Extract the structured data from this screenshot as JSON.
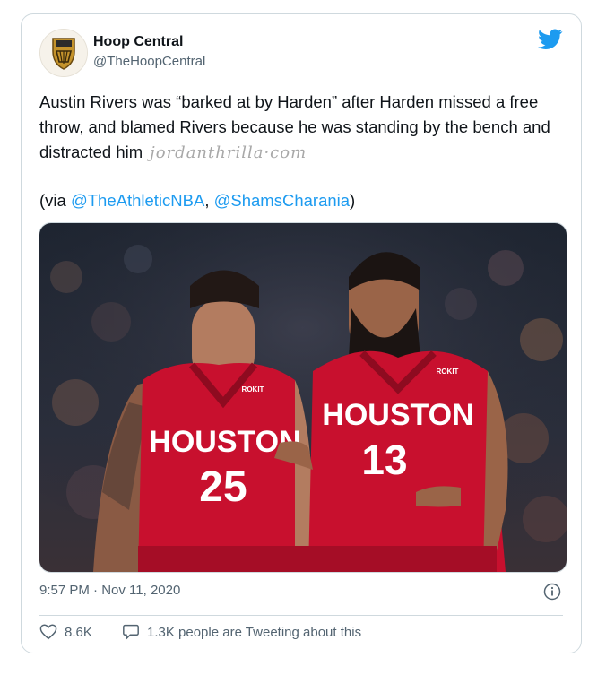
{
  "tweet": {
    "author_name": "Hoop Central",
    "author_handle": "@TheHoopCentral",
    "body_text": "Austin Rivers was “barked at by Harden” after Harden missed a free throw, and blamed Rivers because he was standing by the bench and distracted him",
    "watermark": "jordanthrilla·com",
    "via_prefix": "(via ",
    "via_link_1": "@TheAthleticNBA",
    "via_separator": ", ",
    "via_link_2": "@ShamsCharania",
    "via_suffix": ")",
    "timestamp": "9:57 PM · Nov 11, 2020",
    "likes": "8.6K",
    "conversation": "1.3K people are Tweeting about this"
  },
  "photo": {
    "left_jersey_team": "HOUSTON",
    "left_jersey_number": "25",
    "right_jersey_team": "HOUSTON",
    "right_jersey_number": "13",
    "sponsor_patch": "ROKIT"
  },
  "icons": {
    "twitter": "twitter-bird-icon",
    "info": "info-icon",
    "like": "heart-icon",
    "reply": "speech-bubble-icon"
  },
  "colors": {
    "accent": "#1d9bf0",
    "text": "#0f1419",
    "muted": "#536471",
    "jersey_red": "#c8102e"
  }
}
